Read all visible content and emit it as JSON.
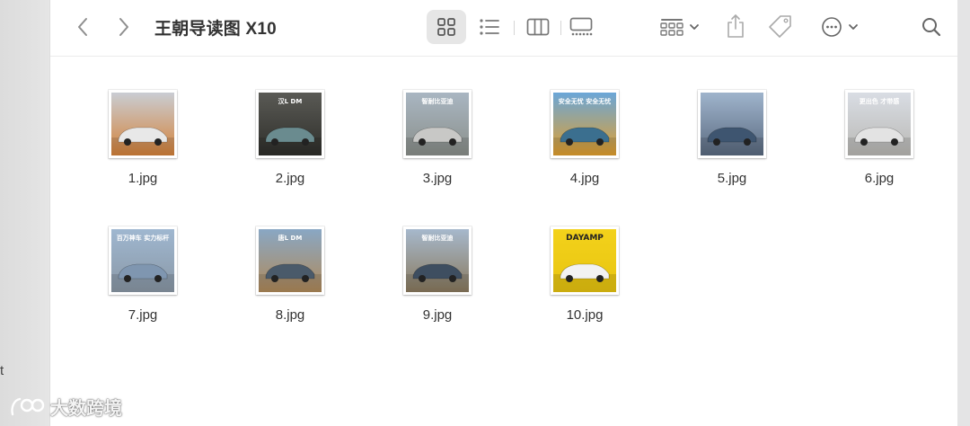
{
  "window": {
    "title": "王朝导读图 X10"
  },
  "sidebar": {
    "stray_char": "t"
  },
  "toolbar": {
    "back_icon": "chevron-left-icon",
    "forward_icon": "chevron-right-icon",
    "views": [
      {
        "name": "icon-view",
        "icon": "grid-icon",
        "selected": true
      },
      {
        "name": "list-view",
        "icon": "list-icon",
        "selected": false
      },
      {
        "name": "column-view",
        "icon": "columns-icon",
        "selected": false
      },
      {
        "name": "gallery-view",
        "icon": "gallery-icon",
        "selected": false
      }
    ],
    "group_icon": "group-by-icon",
    "share_icon": "share-icon",
    "tag_icon": "tag-icon",
    "more_icon": "ellipsis-icon",
    "search_icon": "search-icon"
  },
  "files": [
    {
      "name": "1.jpg",
      "ad_text": "",
      "bg_top": "#c9cdd3",
      "bg_bottom": "#d4823a",
      "car": "#e8e8e8"
    },
    {
      "name": "2.jpg",
      "ad_text": "汉L DM",
      "bg_top": "#5a5a55",
      "bg_bottom": "#2e2e2a",
      "car": "#6a8b8f"
    },
    {
      "name": "3.jpg",
      "ad_text": "智耐比亚迪",
      "bg_top": "#a9b6c2",
      "bg_bottom": "#8a8f8a",
      "car": "#c8c8c6"
    },
    {
      "name": "4.jpg",
      "ad_text": "安全无忧 安全无忧",
      "bg_top": "#6aa6d8",
      "bg_bottom": "#e2a02e",
      "car": "#3b6f8f"
    },
    {
      "name": "5.jpg",
      "ad_text": "",
      "bg_top": "#9fb4cc",
      "bg_bottom": "#5a6a80",
      "car": "#3e5570"
    },
    {
      "name": "6.jpg",
      "ad_text": "更出色 才带感",
      "bg_top": "#d9dde4",
      "bg_bottom": "#b9b8b4",
      "car": "#e3e3e3"
    },
    {
      "name": "7.jpg",
      "ad_text": "百万神车 实力标杆",
      "bg_top": "#9fb7d0",
      "bg_bottom": "#8a98a6",
      "car": "#7f96b0"
    },
    {
      "name": "8.jpg",
      "ad_text": "唐L DM",
      "bg_top": "#89a7c4",
      "bg_bottom": "#b08a5a",
      "car": "#4a5a6a"
    },
    {
      "name": "9.jpg",
      "ad_text": "智耐比亚迪",
      "bg_top": "#a6b8cc",
      "bg_bottom": "#8a7a5e",
      "car": "#3e4e60"
    },
    {
      "name": "10.jpg",
      "ad_text": "DAYAMP",
      "bg_top": "#f3d21b",
      "bg_bottom": "#e8c410",
      "car": "#f2f2f2"
    }
  ],
  "watermark": {
    "text": "大数跨境"
  }
}
